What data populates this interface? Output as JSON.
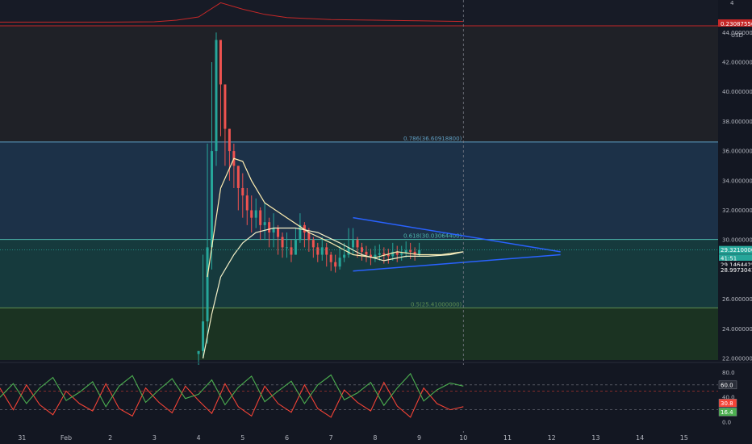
{
  "colors": {
    "background": "#131722",
    "pane_background": "#171b26",
    "top_band": "#1f2127",
    "fib_0786_zone": "#1c3148",
    "fib_0618_zone": "#163a3d",
    "fib_05_zone": "#1b3322",
    "fib_0786_line": "#5e9ec2",
    "fib_0618_line": "#4db6ac",
    "fib_05_line": "#5f8f52",
    "candle_up": "#26a69a",
    "candle_down": "#ef5350",
    "ma_fast": "#ffeeb0",
    "ma_slow": "#f5f0c8",
    "trendline": "#2962ff",
    "ratio_line": "#c62828",
    "rsi_green": "#4caf50",
    "rsi_red": "#f44336",
    "crosshair": "#787b86"
  },
  "ratio_pane": {
    "tag_value": "0.23087556",
    "top_value": "4"
  },
  "price_pane": {
    "currency": "USD",
    "tick_labels": [
      "44.00000000",
      "42.00000000",
      "40.00000000",
      "38.00000000",
      "36.00000000",
      "34.00000000",
      "32.00000000",
      "30.00000000",
      "28.00000000",
      "26.00000000",
      "24.00000000",
      "22.00000000"
    ],
    "tick_values": [
      44,
      42,
      40,
      38,
      36,
      34,
      32,
      30,
      28,
      26,
      24,
      22
    ],
    "price_tags": [
      {
        "text": "29.32100000",
        "value": 29.321,
        "bg": "#26a69a"
      },
      {
        "text": "41:51",
        "value": 28.75,
        "bg": "#26a69a"
      },
      {
        "text": "29.14644257",
        "value": 28.32,
        "bg": "#131722"
      },
      {
        "text": "28.99730417",
        "value": 27.97,
        "bg": "#131722"
      }
    ]
  },
  "fib_levels": [
    {
      "label": "0.786(36.60918800)",
      "value": 36.609,
      "color": "#5e9ec2"
    },
    {
      "label": "0.618(30.03064400)",
      "value": 30.03,
      "color": "#4db6ac"
    },
    {
      "label": "0.5(25.41000000)",
      "value": 25.41,
      "color": "#5f8f52"
    }
  ],
  "rsi_pane": {
    "tick_labels": [
      "80.0",
      "60.0",
      "40.0",
      "20.0",
      "0.0"
    ],
    "tick_values": [
      80,
      60,
      40,
      20,
      0
    ],
    "value_tags": [
      {
        "text": "60.0",
        "value": 60,
        "bg": "#2a2e39"
      },
      {
        "text": "30.8",
        "value": 30.8,
        "bg": "#f44336"
      },
      {
        "text": "16.4",
        "value": 16.4,
        "bg": "#4caf50"
      }
    ]
  },
  "x_axis": {
    "labels": [
      "31",
      "Feb",
      "2",
      "3",
      "4",
      "5",
      "6",
      "7",
      "8",
      "9",
      "10",
      "11",
      "12",
      "13",
      "14",
      "15"
    ],
    "values": [
      -1,
      0,
      1,
      2,
      3,
      4,
      5,
      6,
      7,
      8,
      9,
      10,
      11,
      12,
      13,
      14
    ]
  },
  "chart_data": {
    "type": "candlestick",
    "x_unit": "days from Feb 1",
    "price_ylim": [
      22,
      44
    ],
    "price_series": {
      "name": "",
      "x": [
        3.0,
        3.1,
        3.2,
        3.3,
        3.4,
        3.5,
        3.6,
        3.7,
        3.8,
        3.9,
        4.0,
        4.1,
        4.2,
        4.3,
        4.4,
        4.5,
        4.6,
        4.7,
        4.8,
        4.9,
        5.0,
        5.1,
        5.2,
        5.3,
        5.4,
        5.5,
        5.6,
        5.7,
        5.8,
        5.9,
        6.0,
        6.1,
        6.2,
        6.3,
        6.4,
        6.5,
        6.6,
        6.7,
        6.8,
        6.9,
        7.0,
        7.1,
        7.2,
        7.3,
        7.4,
        7.5,
        7.6,
        7.7,
        7.8,
        7.9,
        8.0,
        8.1,
        8.2,
        8.3,
        8.4,
        8.5,
        8.6,
        8.7,
        8.8,
        8.9,
        9.0
      ],
      "close": [
        22.5,
        24.5,
        29.5,
        36.0,
        43.5,
        40.5,
        37.5,
        36.0,
        35.0,
        33.5,
        33.0,
        32.0,
        31.5,
        32.0,
        31.0,
        31.2,
        30.5,
        30.8,
        30.2,
        29.5,
        29.5,
        29.0,
        30.0,
        31.0,
        30.5,
        30.0,
        29.5,
        29.0,
        29.5,
        29.0,
        28.5,
        28.2,
        28.8,
        29.0,
        29.5,
        30.0,
        29.5,
        29.2,
        29.0,
        28.8,
        29.0,
        29.1,
        29.0,
        28.9,
        29.2,
        29.0,
        29.1,
        29.3,
        29.2,
        29.0,
        29.321
      ],
      "high": [
        22.5,
        29.0,
        36.5,
        42.0,
        44.0,
        43.0,
        39.5,
        37.5,
        36.5,
        35.0,
        34.5,
        33.5,
        33.0,
        32.8,
        32.2,
        32.5,
        31.5,
        31.8,
        31.0,
        30.5,
        30.5,
        30.0,
        30.8,
        31.8,
        31.2,
        30.8,
        30.2,
        29.8,
        30.2,
        29.8,
        29.2,
        29.0,
        29.6,
        29.8,
        30.8,
        30.8,
        30.2,
        29.8,
        29.6,
        29.4,
        29.6,
        29.7,
        29.5,
        29.4,
        29.8,
        29.6,
        29.6,
        29.9,
        29.8,
        29.5,
        29.8
      ],
      "low": [
        21.5,
        22.0,
        23.0,
        28.0,
        35.0,
        37.0,
        35.0,
        34.0,
        33.5,
        32.0,
        31.5,
        31.0,
        30.5,
        30.8,
        30.0,
        30.0,
        29.5,
        29.5,
        29.0,
        28.8,
        28.8,
        28.5,
        29.0,
        29.8,
        29.5,
        29.2,
        28.8,
        28.5,
        28.6,
        28.2,
        27.9,
        27.8,
        28.0,
        28.5,
        28.8,
        29.0,
        28.8,
        28.6,
        28.5,
        28.3,
        28.5,
        28.6,
        28.4,
        28.4,
        28.6,
        28.5,
        28.6,
        28.8,
        28.7,
        28.6,
        28.9
      ]
    },
    "ma_series": [
      {
        "name": "",
        "x": [
          3.2,
          3.5,
          3.8,
          4.0,
          4.2,
          4.5,
          5.0,
          5.5,
          6.0,
          6.5,
          7.0,
          7.5,
          8.0,
          8.5,
          9.0
        ],
        "y": [
          27.5,
          33.5,
          35.5,
          35.3,
          34.0,
          32.5,
          31.5,
          30.5,
          29.8,
          29.0,
          28.8,
          29.2,
          29.0,
          29.0,
          29.2
        ]
      },
      {
        "name": "",
        "x": [
          3.1,
          3.3,
          3.5,
          3.8,
          4.0,
          4.3,
          4.7,
          5.2,
          5.7,
          6.2,
          6.7,
          7.2,
          7.7,
          8.2,
          8.7,
          9.0
        ],
        "y": [
          22.0,
          25.0,
          27.5,
          29.0,
          29.8,
          30.5,
          30.8,
          30.8,
          30.5,
          29.8,
          29.0,
          28.6,
          28.9,
          28.9,
          29.0,
          29.2
        ]
      }
    ],
    "trendlines": [
      {
        "x": [
          6.5,
          11.2
        ],
        "y": [
          31.5,
          29.2
        ]
      },
      {
        "x": [
          6.5,
          11.2
        ],
        "y": [
          27.9,
          29.0
        ]
      }
    ],
    "rsi_ylim": [
      0,
      90
    ],
    "rsi_green": {
      "x": [
        -1.5,
        -1.2,
        -0.9,
        -0.6,
        -0.3,
        0.0,
        0.3,
        0.6,
        0.9,
        1.2,
        1.5,
        1.8,
        2.1,
        2.4,
        2.7,
        3.0,
        3.3,
        3.6,
        3.9,
        4.2,
        4.5,
        4.8,
        5.1,
        5.4,
        5.7,
        6.0,
        6.3,
        6.6,
        6.9,
        7.2,
        7.5,
        7.8,
        8.1,
        8.4,
        8.7,
        9.0
      ],
      "y": [
        40,
        62,
        30,
        55,
        72,
        35,
        48,
        65,
        25,
        58,
        75,
        32,
        52,
        70,
        38,
        45,
        68,
        28,
        56,
        74,
        33,
        50,
        66,
        30,
        60,
        76,
        36,
        47,
        64,
        27,
        55,
        78,
        34,
        52,
        63,
        58
      ]
    },
    "rsi_red": {
      "x": [
        -1.5,
        -1.2,
        -0.9,
        -0.6,
        -0.3,
        0.0,
        0.3,
        0.6,
        0.9,
        1.2,
        1.5,
        1.8,
        2.1,
        2.4,
        2.7,
        3.0,
        3.3,
        3.6,
        3.9,
        4.2,
        4.5,
        4.8,
        5.1,
        5.4,
        5.7,
        6.0,
        6.3,
        6.6,
        6.9,
        7.2,
        7.5,
        7.8,
        8.1,
        8.4,
        8.7,
        9.0
      ],
      "y": [
        55,
        20,
        60,
        28,
        12,
        50,
        30,
        18,
        62,
        22,
        10,
        55,
        32,
        15,
        58,
        35,
        14,
        62,
        25,
        10,
        58,
        30,
        16,
        60,
        22,
        8,
        52,
        32,
        18,
        64,
        26,
        8,
        55,
        30,
        20,
        25
      ]
    },
    "ratio_series": {
      "x": [
        -2.0,
        0.0,
        1.0,
        2.0,
        2.5,
        3.0,
        3.5,
        4.0,
        4.5,
        5.0,
        6.0,
        7.0,
        8.0,
        9.0
      ],
      "y": [
        0.2,
        0.2,
        0.2,
        0.25,
        0.5,
        1.0,
        3.2,
        2.2,
        1.4,
        0.9,
        0.6,
        0.5,
        0.4,
        0.3
      ]
    }
  }
}
